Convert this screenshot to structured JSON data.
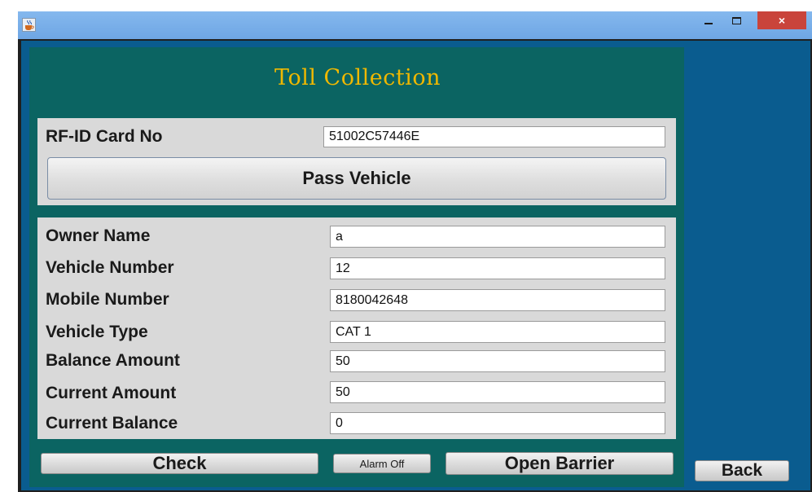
{
  "window": {
    "app_icon": "java-cup-icon",
    "controls": {
      "minimize": "minimize-icon",
      "maximize": "maximize-icon",
      "close": "×"
    }
  },
  "app_title": "Toll Collection",
  "rfid": {
    "label": "RF-ID Card No",
    "value": "51002C57446E",
    "pass_button": "Pass Vehicle"
  },
  "details": [
    {
      "label": "Owner Name",
      "value": "a"
    },
    {
      "label": "Vehicle Number",
      "value": "12"
    },
    {
      "label": "Mobile Number",
      "value": "8180042648"
    },
    {
      "label": "Vehicle Type",
      "value": "CAT 1"
    },
    {
      "label": "Balance Amount",
      "value": "50"
    },
    {
      "label": "Current Amount",
      "value": "50"
    },
    {
      "label": "Current Balance",
      "value": "0"
    }
  ],
  "buttons": {
    "check": "Check",
    "alarm_off": "Alarm Off",
    "open_barrier": "Open Barrier",
    "back": "Back"
  },
  "colors": {
    "panel": "#0b6462",
    "side": "#0a5c8f",
    "title_text": "#f0b800",
    "title_bar": "#6ea6e4",
    "close_button": "#c9443b"
  }
}
